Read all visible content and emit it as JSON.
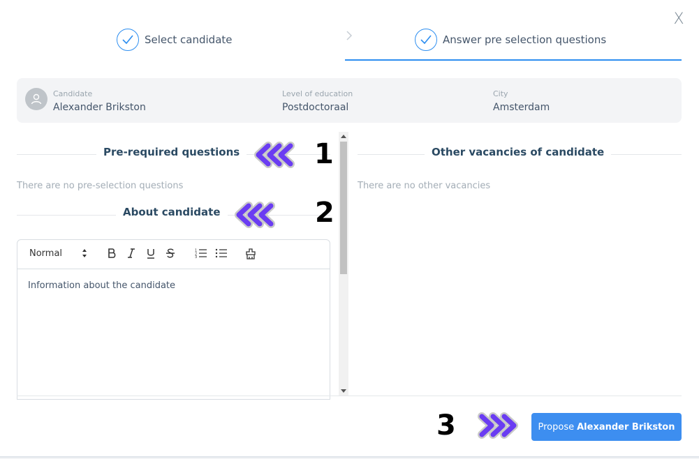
{
  "steps": [
    {
      "label": "Select candidate"
    },
    {
      "label": "Answer pre selection questions"
    }
  ],
  "candidate_info": {
    "candidate_label": "Candidate",
    "candidate_value": "Alexander Brikston",
    "education_label": "Level of education",
    "education_value": "Postdoctoraal",
    "city_label": "City",
    "city_value": "Amsterdam"
  },
  "left": {
    "prerequired_title": "Pre-required questions",
    "no_questions_text": "There are no pre-selection questions",
    "about_title": "About candidate",
    "editor": {
      "format_select": "Normal",
      "body_text": "Information about the candidate"
    }
  },
  "right": {
    "title": "Other vacancies of candidate",
    "no_vacancies_text": "There are no other vacancies"
  },
  "annotations": {
    "one": "1",
    "two": "2",
    "three": "3"
  },
  "footer": {
    "propose_prefix": "Propose",
    "propose_name": "Alexander Brikston"
  },
  "close_glyph": "X",
  "colors": {
    "accent": "#3d8ef0",
    "arrow": "#6a3cf2"
  }
}
